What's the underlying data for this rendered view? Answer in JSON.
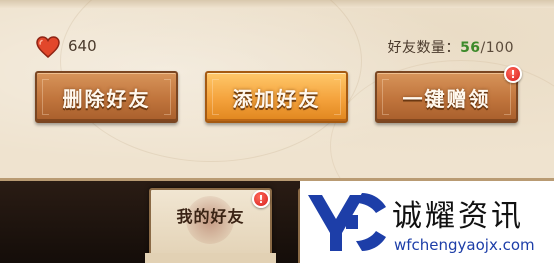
{
  "header": {
    "hearts_value": "640",
    "friend_count_label": "好友数量：",
    "friend_count_current": "56",
    "friend_count_max": "/100"
  },
  "buttons": {
    "delete_friend": "删除好友",
    "add_friend": "添加好友",
    "gift_all": "一键赠领"
  },
  "badges": {
    "gift_all": "!",
    "my_friends_tab": "!"
  },
  "tabs": {
    "my_friends": "我的好友"
  },
  "watermark": {
    "title": "诚耀资讯",
    "url": "wfchengyaojx.com"
  },
  "colors": {
    "count_current": "#3d8a2a",
    "button_brown": "#c0743c",
    "button_orange": "#f4a23c",
    "badge_red": "#d61e1e",
    "watermark_blue": "#1d3ea8"
  },
  "icons": {
    "heart": "heart-icon",
    "logo": "watermark-logo"
  }
}
